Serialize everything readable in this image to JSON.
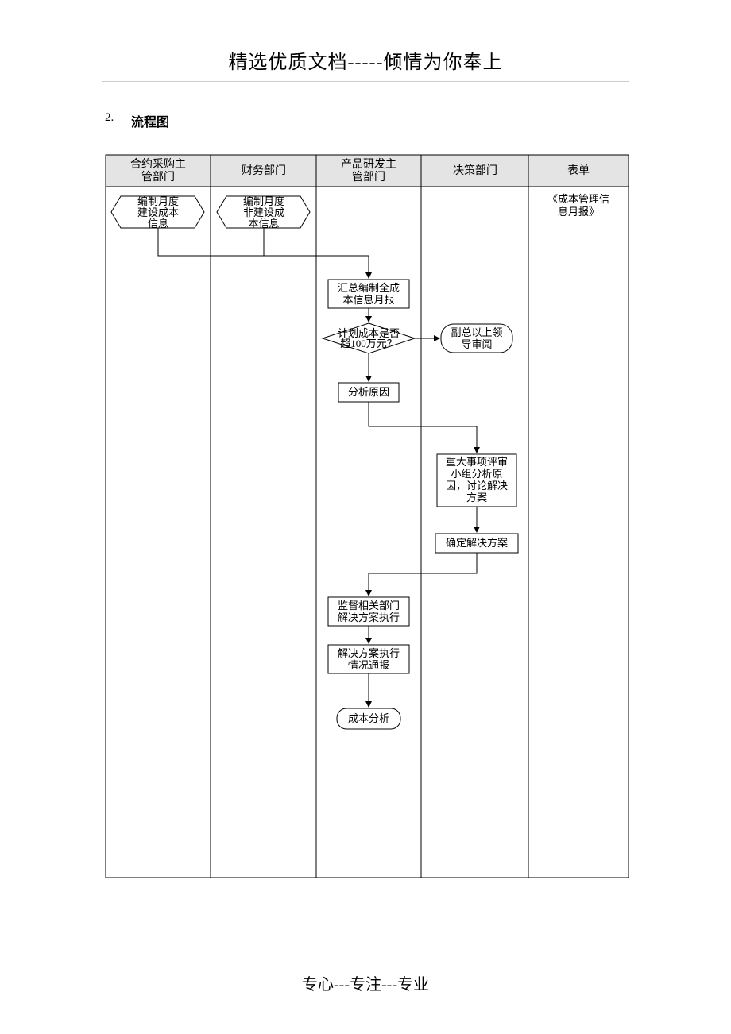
{
  "header": "精选优质文档-----倾情为你奉上",
  "section": {
    "num": "2.",
    "title": "流程图"
  },
  "lanes": {
    "l1a": "合约采购主",
    "l1b": "管部门",
    "l2": "财务部门",
    "l3a": "产品研发主",
    "l3b": "管部门",
    "l4": "决策部门",
    "l5": "表单"
  },
  "nodes": {
    "a1": "编制月度",
    "a2": "建设成本",
    "a3": "信息",
    "b1": "编制月度",
    "b2": "非建设成",
    "b3": "本信息",
    "c1": "汇总编制全成",
    "c2": "本信息月报",
    "d1": "计划成本是否",
    "d2": "超100万元？",
    "e": "分析原因",
    "f1": "副总以上领",
    "f2": "导审阅",
    "g1": "重大事项评审",
    "g2": "小组分析原",
    "g3": "因，讨论解决",
    "g4": "方案",
    "h": "确定解决方案",
    "i1": "监督相关部门",
    "i2": "解决方案执行",
    "j1": "解决方案执行",
    "j2": "情况通报",
    "k": "成本分析",
    "form1": "《成本管理信",
    "form2": "息月报》"
  },
  "footer": "专心---专注---专业"
}
